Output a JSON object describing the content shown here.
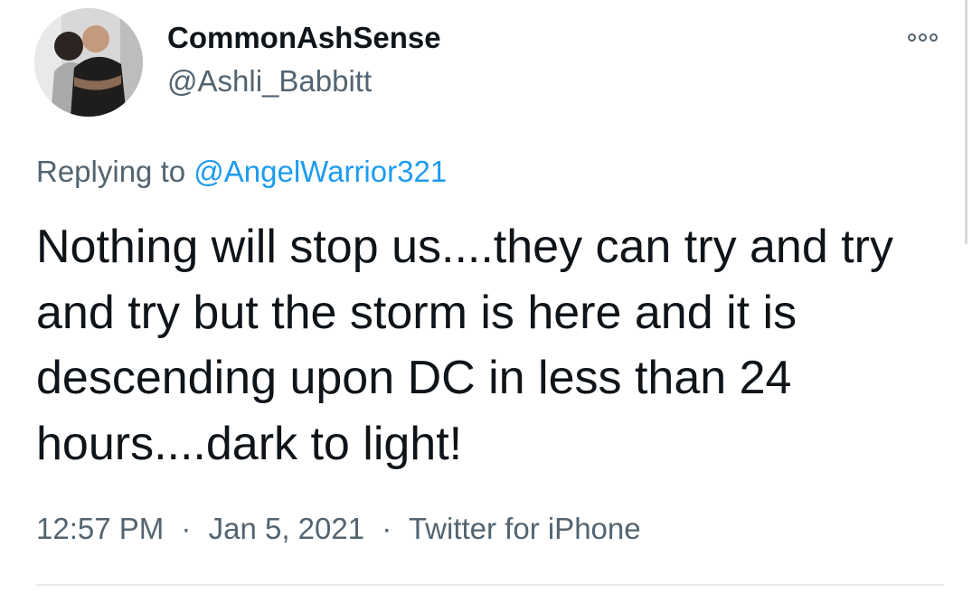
{
  "author": {
    "display_name": "CommonAshSense",
    "handle": "@Ashli_Babbitt",
    "avatar_icon": "profile-photo"
  },
  "reply": {
    "prefix": "Replying to",
    "mention": "@AngelWarrior321"
  },
  "tweet": {
    "text": "Nothing will stop us....they can try and try and try but the storm is here and it is descending upon DC in less than 24 hours....dark to light!"
  },
  "meta": {
    "time": "12:57 PM",
    "separator": "·",
    "date": "Jan 5, 2021",
    "source": "Twitter for iPhone"
  },
  "colors": {
    "link": "#1d9bf0",
    "secondary_text": "#536471",
    "primary_text": "#0f1419"
  },
  "icons": {
    "more": "more-options-icon"
  }
}
